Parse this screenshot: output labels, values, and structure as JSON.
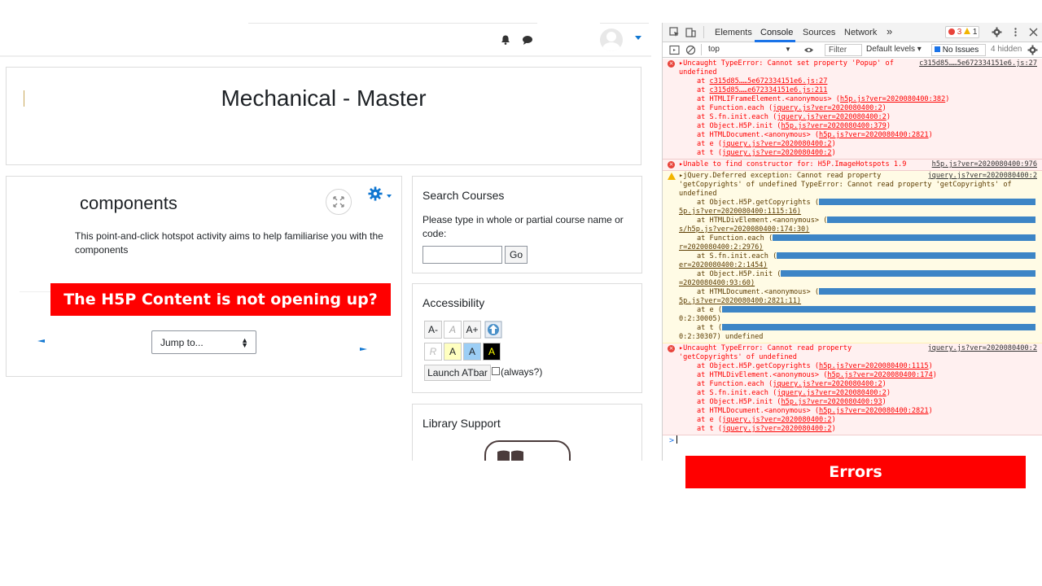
{
  "moodle": {
    "page_title": "Mechanical - Master",
    "activity_title": "components",
    "description": "This point-and-click hotspot activity aims to help familiarise you with the components",
    "jump_label": "Jump to...",
    "search": {
      "title": "Search Courses",
      "prompt": "Please type in whole or partial course name or code:",
      "input_value": "",
      "go_label": "Go"
    },
    "accessibility": {
      "title": "Accessibility",
      "buttons_row1": [
        "A-",
        "A",
        "A+"
      ],
      "buttons_row2": [
        "R",
        "A",
        "A",
        "A"
      ],
      "launch_label": "Launch ATbar",
      "always_label": "(always?)"
    },
    "library": {
      "title": "Library Support"
    }
  },
  "annotations": {
    "h5p_banner": "The H5P Content is not opening up?",
    "errors_banner": "Errors"
  },
  "devtools": {
    "tabs": [
      "Elements",
      "Console",
      "Sources",
      "Network"
    ],
    "more": "»",
    "error_count": "3",
    "warning_count": "1",
    "context": "top",
    "filter_placeholder": "Filter",
    "levels": "Default levels ▾",
    "no_issues": "No Issues",
    "hidden": "4 hidden",
    "messages": [
      {
        "level": "error",
        "text": "▸Uncaught TypeError: Cannot set property 'Popup' of",
        "source": "c315d85……5e672334151e6.js:27",
        "cont": "undefined",
        "trace": [
          [
            "at ",
            "c315d85……5e672334151e6.js:27",
            ""
          ],
          [
            "at ",
            "c315d85……e672334151e6.js:211",
            ""
          ],
          [
            "at HTMLIFrameElement.<anonymous> (",
            "h5p.js?ver=2020080400:382",
            ")"
          ],
          [
            "at Function.each (",
            "jquery.js?ver=2020080400:2",
            ")"
          ],
          [
            "at S.fn.init.each (",
            "jquery.js?ver=2020080400:2",
            ")"
          ],
          [
            "at Object.H5P.init (",
            "h5p.js?ver=2020080400:379",
            ")"
          ],
          [
            "at HTMLDocument.<anonymous> (",
            "h5p.js?ver=2020080400:2821",
            ")"
          ],
          [
            "at e (",
            "jquery.js?ver=2020080400:2",
            ")"
          ],
          [
            "at t (",
            "jquery.js?ver=2020080400:2",
            ")"
          ]
        ]
      },
      {
        "level": "error",
        "text": "▸Unable to find constructor for: H5P.ImageHotspots 1.9",
        "source": "h5p.js?ver=2020080400:976"
      },
      {
        "level": "warn",
        "text": "▸jQuery.Deferred exception: Cannot read property",
        "source": "jquery.js?ver=2020080400:2",
        "cont": "'getCopyrights' of undefined TypeError: Cannot read property 'getCopyrights' of",
        "cont2": "undefined",
        "redacted_trace": [
          {
            "pre": "at Object.H5P.getCopyrights (",
            "tail": "5p.js?ver=2020080400:1115:16)"
          },
          {
            "pre": "at HTMLDivElement.<anonymous> (",
            "tail": "s/h5p.js?ver=2020080400:174:30)"
          },
          {
            "pre": "at Function.each (",
            "tail": "r=2020080400:2:2976)"
          },
          {
            "pre": "at S.fn.init.each (",
            "tail": "er=2020080400:2:1454)"
          },
          {
            "pre": "at Object.H5P.init (",
            "tail": "=2020080400:93:60)"
          },
          {
            "pre": "at HTMLDocument.<anonymous> (",
            "tail": "5p.js?ver=2020080400:2821:11)"
          },
          {
            "pre": "at e (",
            "tail": "0:2:30005)"
          },
          {
            "pre": "at t (",
            "tail": "0:2:30307) undefined"
          }
        ]
      },
      {
        "level": "error",
        "text": "▸Uncaught TypeError: Cannot read property",
        "source": "jquery.js?ver=2020080400:2",
        "cont": "'getCopyrights' of undefined",
        "trace": [
          [
            "at Object.H5P.getCopyrights (",
            "h5p.js?ver=2020080400:1115",
            ")"
          ],
          [
            "at HTMLDivElement.<anonymous> (",
            "h5p.js?ver=2020080400:174",
            ")"
          ],
          [
            "at Function.each (",
            "jquery.js?ver=2020080400:2",
            ")"
          ],
          [
            "at S.fn.init.each (",
            "jquery.js?ver=2020080400:2",
            ")"
          ],
          [
            "at Object.H5P.init (",
            "h5p.js?ver=2020080400:93",
            ")"
          ],
          [
            "at HTMLDocument.<anonymous> (",
            "h5p.js?ver=2020080400:2821",
            ")"
          ],
          [
            "at e (",
            "jquery.js?ver=2020080400:2",
            ")"
          ],
          [
            "at t (",
            "jquery.js?ver=2020080400:2",
            ")"
          ]
        ]
      }
    ],
    "prompt": ">"
  },
  "colors": {
    "accent": "#1177d1",
    "banner_red": "#ff0000",
    "console_error": "#fe0000",
    "redaction": "#3d85c6"
  }
}
